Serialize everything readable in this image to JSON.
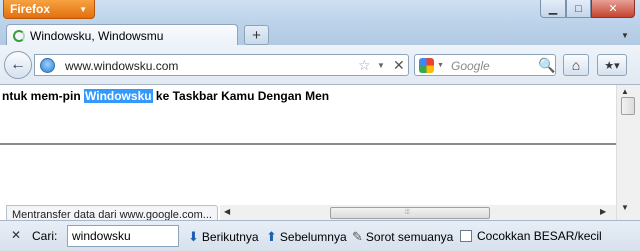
{
  "window": {
    "app_menu": "Firefox",
    "minimize": "▁",
    "maximize": "□",
    "close": "✕"
  },
  "tabs": [
    {
      "title": "Windowsku, Windowsmu",
      "loading": true
    }
  ],
  "tabstrip": {
    "new_tab": "+",
    "list_all": "▼"
  },
  "navbar": {
    "back": "←",
    "url": "www.windowsku.com",
    "bookmark_star": "☆",
    "url_dropdown": "▼",
    "stop": "✕",
    "search_placeholder": "Google",
    "search_engine_dropdown": "▼",
    "search_go": "🔍",
    "home": "⌂",
    "bookmarks": "★▾"
  },
  "content": {
    "headline_before": "ntuk mem-pin ",
    "headline_highlight": "Windowsku",
    "headline_after": " ke Taskbar Kamu Dengan Men",
    "status": "Mentransfer data dari www.google.com..."
  },
  "scrollbars": {
    "up": "▲",
    "down": "▼",
    "left": "◀",
    "right": "▶",
    "grip": "⦙⦙⦙"
  },
  "findbar": {
    "close": "✕",
    "label": "Cari:",
    "value": "windowsku",
    "next": "Berikutnya",
    "next_icon": "⬇",
    "prev": "Sebelumnya",
    "prev_icon": "⬆",
    "highlight": "Sorot semuanya",
    "highlight_icon": "✎",
    "match_case": "Cocokkan BESAR/kecil",
    "match_case_checked": false
  },
  "colors": {
    "firefox_button": "#e2700e",
    "selection": "#3399ff",
    "chrome": "#bcd3ea"
  }
}
